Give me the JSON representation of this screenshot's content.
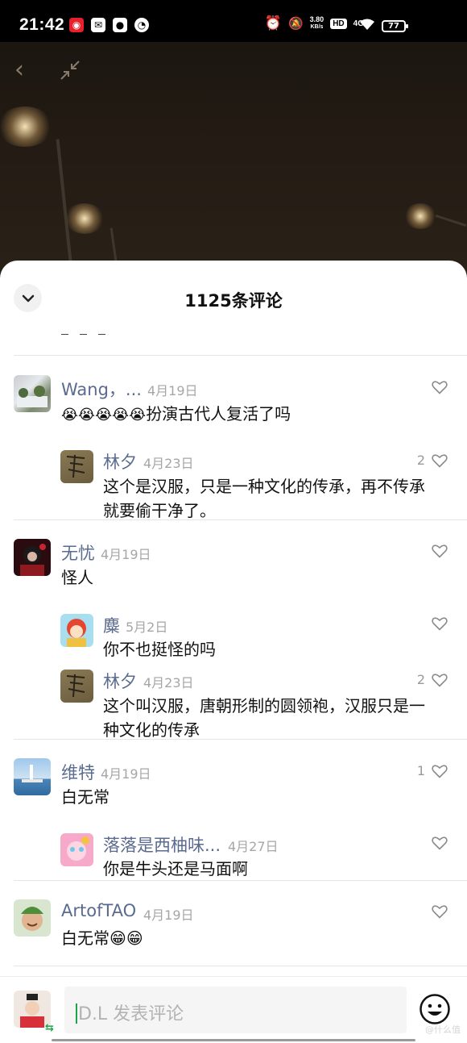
{
  "status_bar": {
    "time": "21:42",
    "net_speed_value": "3.80",
    "net_speed_unit": "KB/s",
    "hd": "HD",
    "signal": "4G",
    "battery": "77"
  },
  "video": {
    "back_icon": "‹"
  },
  "sheet": {
    "title": "1125条评论"
  },
  "comments": [
    {
      "user": "Wang，...",
      "date": "4月19日",
      "text_emoji": "😭😭😭😭😭",
      "text": "扮演古代人复活了吗",
      "likes": "",
      "replies": [
        {
          "user": "林夕",
          "date": "4月23日",
          "likes": "2",
          "line1": "这个是汉服，只是一种文化的传承，再不传承",
          "line2": "就要偷干净了。"
        }
      ]
    },
    {
      "user": "无忧",
      "date": "4月19日",
      "text": "怪人",
      "likes": "",
      "replies": [
        {
          "user": "麋",
          "date": "5月2日",
          "likes": "",
          "line1": "你不也挺怪的吗"
        },
        {
          "user": "林夕",
          "date": "4月23日",
          "likes": "2",
          "line1": "这个叫汉服，唐朝形制的圆领袍，汉服只是一",
          "line2": "种文化的传承"
        }
      ]
    },
    {
      "user": "维特",
      "date": "4月19日",
      "text": "白无常",
      "likes": "1",
      "replies": [
        {
          "user": "落落是西柚味...",
          "date": "4月27日",
          "likes": "",
          "line1": "你是牛头还是马面啊"
        }
      ]
    },
    {
      "user": "ArtofTAO",
      "date": "4月19日",
      "text": "白无常😁😁",
      "likes": ""
    }
  ],
  "input": {
    "placeholder": "D.L  发表评论"
  },
  "watermark": "@什么值",
  "colors": {
    "username": "#5a6b8f",
    "date": "#a6a6a6",
    "accent_green": "#1fa34a"
  }
}
